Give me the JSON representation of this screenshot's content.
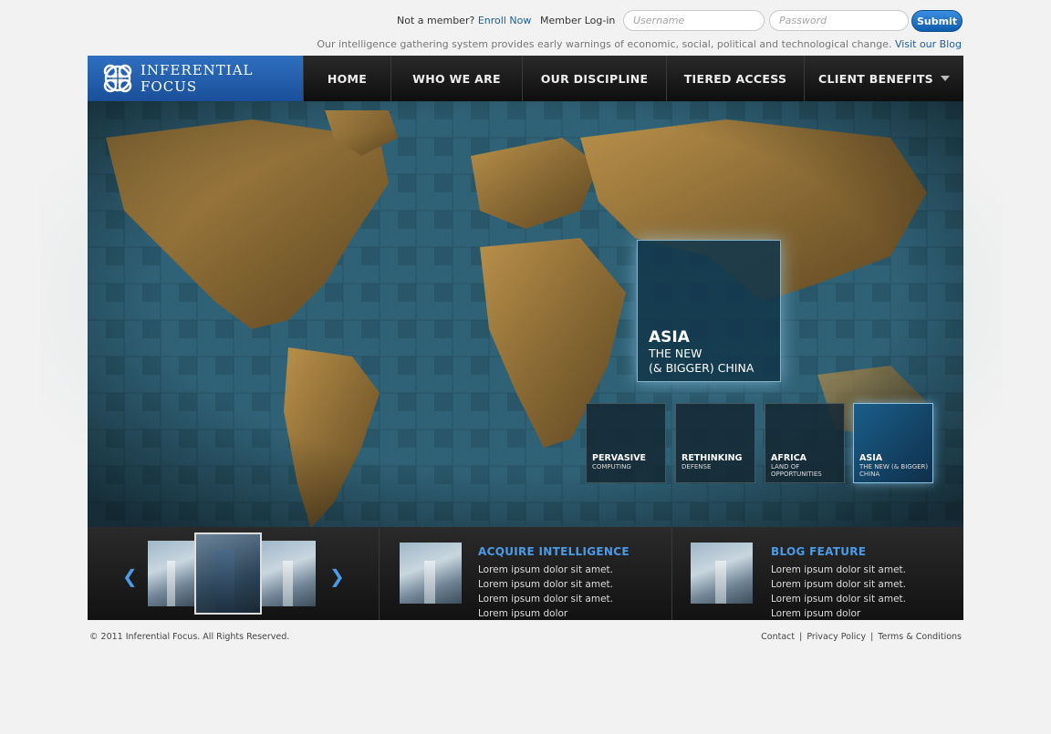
{
  "login": {
    "not_member": "Not a member?",
    "enroll": "Enroll Now",
    "member_login": "Member Log-in",
    "username_placeholder": "Username",
    "password_placeholder": "Password",
    "submit": "Submit"
  },
  "tagline": {
    "text": "Our intelligence gathering system provides early warnings of economic, social, political and technological change.",
    "blog_link": "Visit our Blog"
  },
  "brand": {
    "name": "INFERENTIAL FOCUS"
  },
  "nav": {
    "items": [
      {
        "label": "HOME"
      },
      {
        "label": "WHO WE ARE"
      },
      {
        "label": "OUR DISCIPLINE"
      },
      {
        "label": "TIERED ACCESS"
      },
      {
        "label": "CLIENT BENEFITS"
      }
    ]
  },
  "hero": {
    "feature": {
      "title": "ASIA",
      "line1": "THE NEW",
      "line2": "(& BIGGER) CHINA"
    },
    "thumbs": [
      {
        "title": "PERVASIVE",
        "sub": "COMPUTING"
      },
      {
        "title": "RETHINKING",
        "sub": "DEFENSE"
      },
      {
        "title": "AFRICA",
        "sub": "LAND OF OPPORTUNITIES"
      },
      {
        "title": "ASIA",
        "sub": "THE NEW (& BIGGER) CHINA"
      }
    ]
  },
  "panels": {
    "intel": {
      "title": "ACQUIRE INTELLIGENCE",
      "body": "Lorem ipsum dolor sit amet. Lorem ipsum dolor sit amet. Lorem ipsum dolor sit amet. Lorem ipsum dolor"
    },
    "blog": {
      "title": "BLOG FEATURE",
      "body": "Lorem ipsum dolor sit amet. Lorem ipsum dolor sit amet. Lorem ipsum dolor sit amet. Lorem ipsum dolor"
    }
  },
  "footer": {
    "copyright": "© 2011 Inferential Focus. All Rights Reserved.",
    "contact": "Contact",
    "privacy": "Privacy Policy",
    "terms": "Terms & Conditions"
  },
  "icons": {
    "logo": "globe-logo-icon",
    "prev": "chevron-left-icon",
    "next": "chevron-right-icon",
    "dropdown": "caret-down-icon"
  },
  "colors": {
    "accent": "#4a9be8",
    "brand": "#1a4f9a",
    "link": "#1a5fa8"
  }
}
